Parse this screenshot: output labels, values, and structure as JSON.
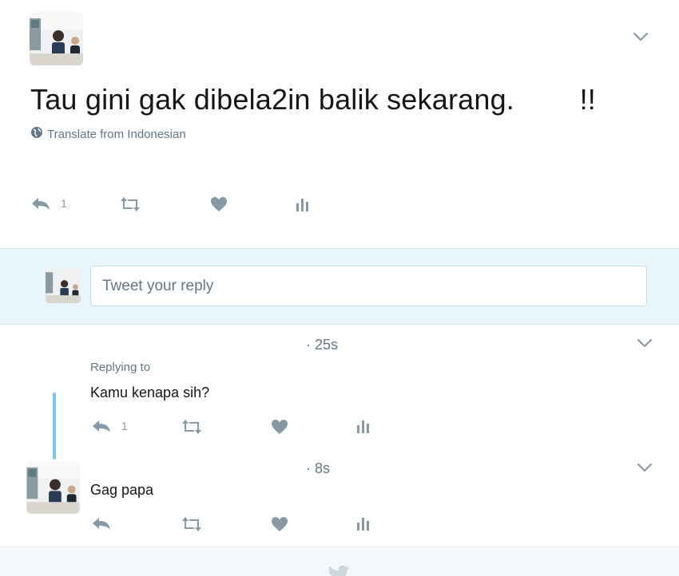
{
  "main_tweet": {
    "text": "Tau gini gak dibela2in balik sekarang.        !!",
    "translate_label": "Translate from Indonesian",
    "reply_count": "1"
  },
  "reply_box": {
    "placeholder": "Tweet your reply"
  },
  "replies": [
    {
      "timestamp": "· 25s",
      "replying_to_label": "Replying to",
      "text": "Kamu kenapa sih?",
      "reply_count": "1"
    },
    {
      "timestamp": "· 8s",
      "text": "Gag papa",
      "reply_count": ""
    }
  ],
  "colors": {
    "action_icon": "#8899a6",
    "reply_band_bg": "#e8f5fd",
    "thread_line": "#80c5ec",
    "text_primary": "#14171a",
    "text_secondary": "#657786"
  },
  "icons": [
    "avatar",
    "chevron-down-icon",
    "globe-icon",
    "reply-icon",
    "retweet-icon",
    "like-icon",
    "analytics-icon",
    "twitter-bird-icon"
  ]
}
